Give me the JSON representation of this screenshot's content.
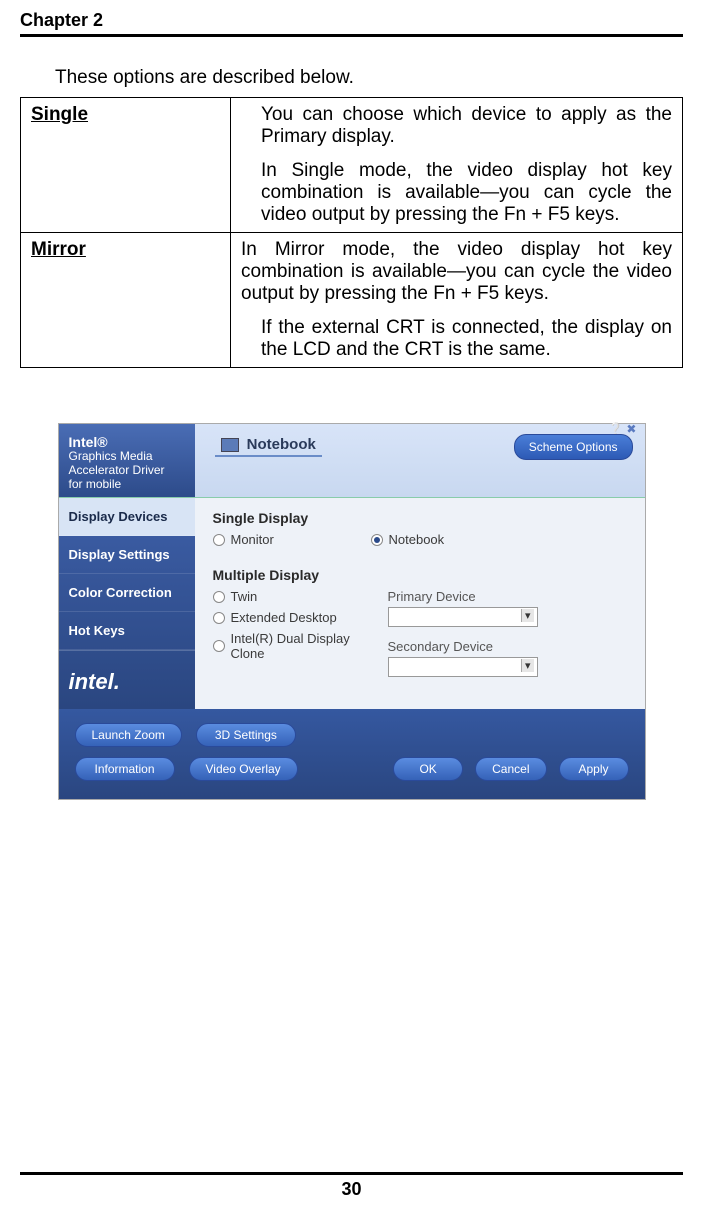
{
  "header": {
    "chapter": "Chapter 2"
  },
  "intro": "These options are described below.",
  "options_table": [
    {
      "name": "Single",
      "paras": [
        "You can choose which device to apply as the Primary display.",
        "In Single mode, the video display hot key combination is available—you can cycle the video output by pressing the Fn + F5 keys."
      ]
    },
    {
      "name": "Mirror",
      "paras": [
        "In Mirror mode, the video display hot key combination is available—you can cycle the video output by pressing the Fn + F5 keys."
      ],
      "indent_paras": [
        "If the external CRT is connected, the display on the LCD and the CRT is the same."
      ]
    }
  ],
  "dialog": {
    "logo": {
      "line1": "Intel®",
      "line2": "Graphics Media",
      "line3": "Accelerator Driver",
      "line4": "for mobile"
    },
    "tab": "Notebook",
    "scheme_btn": "Scheme Options",
    "sidebar": [
      {
        "label": "Display Devices",
        "active": true
      },
      {
        "label": "Display Settings",
        "active": false
      },
      {
        "label": "Color Correction",
        "active": false
      },
      {
        "label": "Hot Keys",
        "active": false
      }
    ],
    "intel_logo": "intel.",
    "single_display": {
      "title": "Single Display",
      "options": [
        {
          "label": "Monitor",
          "selected": false
        },
        {
          "label": "Notebook",
          "selected": true
        }
      ]
    },
    "multiple_display": {
      "title": "Multiple Display",
      "options": [
        {
          "label": "Twin"
        },
        {
          "label": "Extended Desktop"
        },
        {
          "label": "Intel(R) Dual Display Clone"
        }
      ],
      "primary_label": "Primary Device",
      "secondary_label": "Secondary Device"
    },
    "bottom_left": [
      [
        "Launch Zoom",
        "3D Settings"
      ],
      [
        "Information",
        "Video Overlay"
      ]
    ],
    "bottom_right": [
      "OK",
      "Cancel",
      "Apply"
    ]
  },
  "page_number": "30"
}
